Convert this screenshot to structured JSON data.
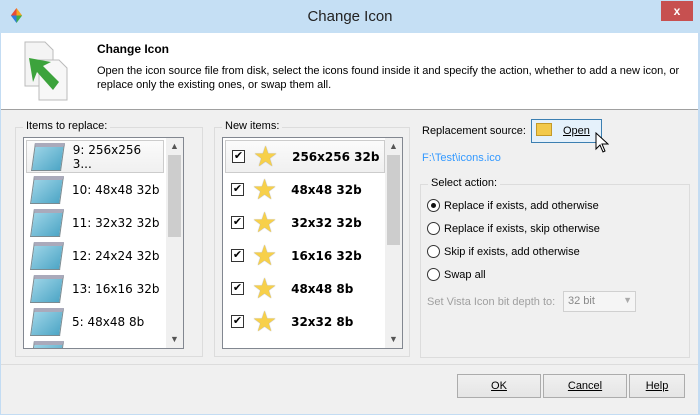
{
  "window": {
    "title": "Change Icon",
    "close_label": "x"
  },
  "header": {
    "title": "Change Icon",
    "description": "Open the icon source file from disk, select the icons found inside it and specify the action, whether to add a new icon, or replace only the existing ones, or swap them all."
  },
  "items_to_replace": {
    "label": "Items to replace:",
    "items": [
      "9: 256x256 3...",
      "10: 48x48 32b",
      "11: 32x32 32b",
      "12: 24x24 32b",
      "13: 16x16 32b",
      "5: 48x48 8b"
    ]
  },
  "new_items": {
    "label": "New items:",
    "items": [
      {
        "label": "256x256 32b",
        "checked": true
      },
      {
        "label": "48x48 32b",
        "checked": true
      },
      {
        "label": "32x32 32b",
        "checked": true
      },
      {
        "label": "16x16 32b",
        "checked": true
      },
      {
        "label": "48x48 8b",
        "checked": true
      },
      {
        "label": "32x32 8b",
        "checked": true
      }
    ]
  },
  "replacement": {
    "label": "Replacement source:",
    "open_label": "Open",
    "path": "F:\\Test\\icons.ico",
    "path_color": "#3399ff"
  },
  "action": {
    "label": "Select action:",
    "options": [
      "Replace if exists, add otherwise",
      "Replace if exists, skip otherwise",
      "Skip if exists, add otherwise",
      "Swap all"
    ],
    "selected": 0,
    "bitdepth_label": "Set Vista Icon bit depth to:",
    "bitdepth_value": "32 bit"
  },
  "buttons": {
    "ok": "OK",
    "cancel": "Cancel",
    "help": "Help"
  }
}
